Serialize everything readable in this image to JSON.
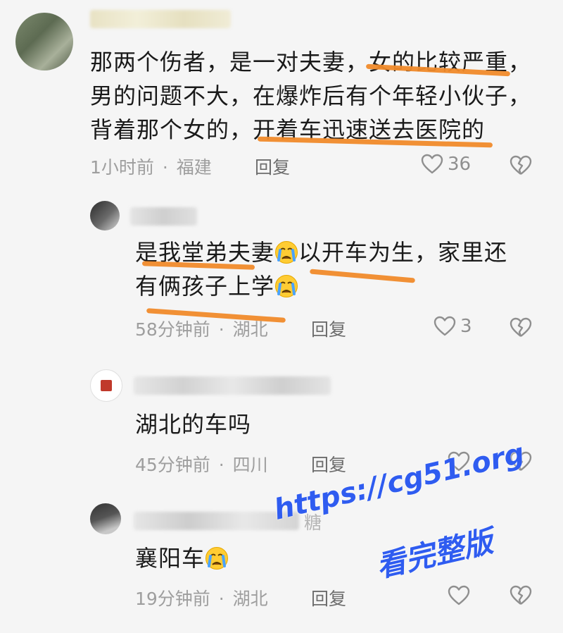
{
  "comments": [
    {
      "lines": [
        "那两个伤者，是一对夫妻，女的比较严重，",
        "男的问题不大，在爆炸后有个年轻小伙子，",
        "背着那个女的，开着车迅速送去医院的"
      ],
      "time": "1小时前",
      "location": "福建",
      "reply_label": "回复",
      "likes": "36"
    },
    {
      "line1_a": "是我堂弟夫妻",
      "line1_b": "以开车为生，家里还",
      "line2": "有俩孩子上学",
      "time": "58分钟前",
      "location": "湖北",
      "reply_label": "回复",
      "likes": "3"
    },
    {
      "text": "湖北的车吗",
      "time": "45分钟前",
      "location": "四川",
      "reply_label": "回复",
      "likes": ""
    },
    {
      "text": "襄阳车",
      "time": "19分钟前",
      "location": "湖北",
      "reply_label": "回复",
      "likes": ""
    }
  ],
  "separator": "·",
  "blurred_name_4_suffix": "糖",
  "watermark": {
    "url": "https://cg51.org",
    "slogan": "看完整版",
    "color": "#2f5cf0"
  },
  "accent_underline_color": "#f08a2a",
  "icons": [
    "heart-icon",
    "broken-heart-icon",
    "crying-emoji-icon"
  ]
}
